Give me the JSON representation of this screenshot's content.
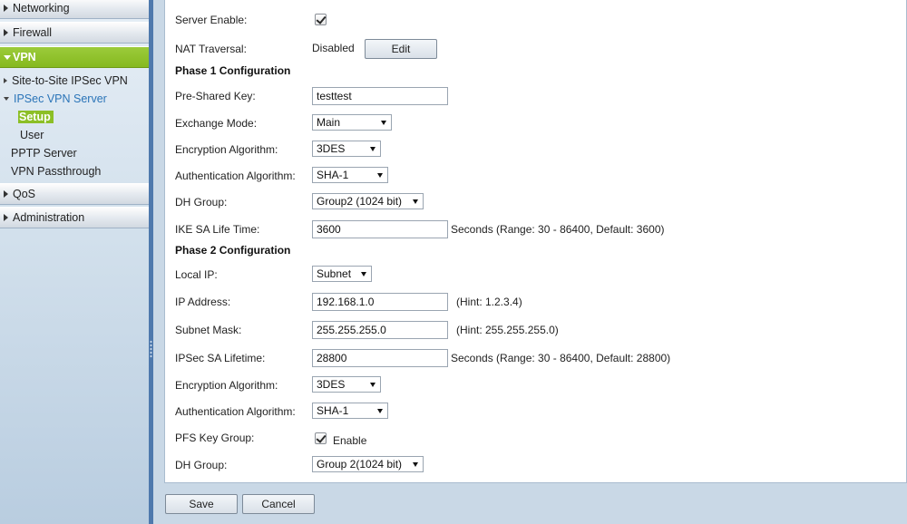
{
  "sidebar": {
    "networking": "Networking",
    "firewall": "Firewall",
    "vpn": "VPN",
    "site_to_site": "Site-to-Site IPSec VPN",
    "ipsec_server": "IPSec VPN Server",
    "setup": "Setup",
    "user": "User",
    "pptp": "PPTP Server",
    "passthrough": "VPN Passthrough",
    "qos": "QoS",
    "administration": "Administration"
  },
  "form": {
    "server_enable_label": "Server Enable:",
    "server_enable_checked": true,
    "nat_label": "NAT Traversal:",
    "nat_value": "Disabled",
    "edit_label": "Edit",
    "phase1_title": "Phase 1 Configuration",
    "psk_label": "Pre-Shared Key:",
    "psk_value": "testtest",
    "exchange_label": "Exchange Mode:",
    "exchange_value": "Main",
    "enc1_label": "Encryption Algorithm:",
    "enc1_value": "3DES",
    "auth1_label": "Authentication Algorithm:",
    "auth1_value": "SHA-1",
    "dh1_label": "DH Group:",
    "dh1_value": "Group2 (1024 bit)",
    "ike_label": "IKE SA Life Time:",
    "ike_value": "3600",
    "ike_hint": "Seconds  (Range: 30 - 86400, Default: 3600)",
    "phase2_title": "Phase 2 Configuration",
    "localip_label": "Local IP:",
    "localip_value": "Subnet",
    "ip_label": "IP Address:",
    "ip_value": "192.168.1.0",
    "ip_hint": "(Hint: 1.2.3.4)",
    "mask_label": "Subnet Mask:",
    "mask_value": "255.255.255.0",
    "mask_hint": "(Hint: 255.255.255.0)",
    "ipsec_label": "IPSec SA Lifetime:",
    "ipsec_value": "28800",
    "ipsec_hint": "Seconds  (Range: 30 - 86400, Default: 28800)",
    "enc2_label": "Encryption Algorithm:",
    "enc2_value": "3DES",
    "auth2_label": "Authentication Algorithm:",
    "auth2_value": "SHA-1",
    "pfs_label": "PFS Key Group:",
    "pfs_enable": "Enable",
    "pfs_checked": true,
    "dh2_label": "DH Group:",
    "dh2_value": "Group 2(1024 bit)"
  },
  "footer": {
    "save": "Save",
    "cancel": "Cancel"
  },
  "colors": {
    "active_menu": "#8cbf26",
    "link": "#2a74b8",
    "divider": "#4e79ad"
  }
}
